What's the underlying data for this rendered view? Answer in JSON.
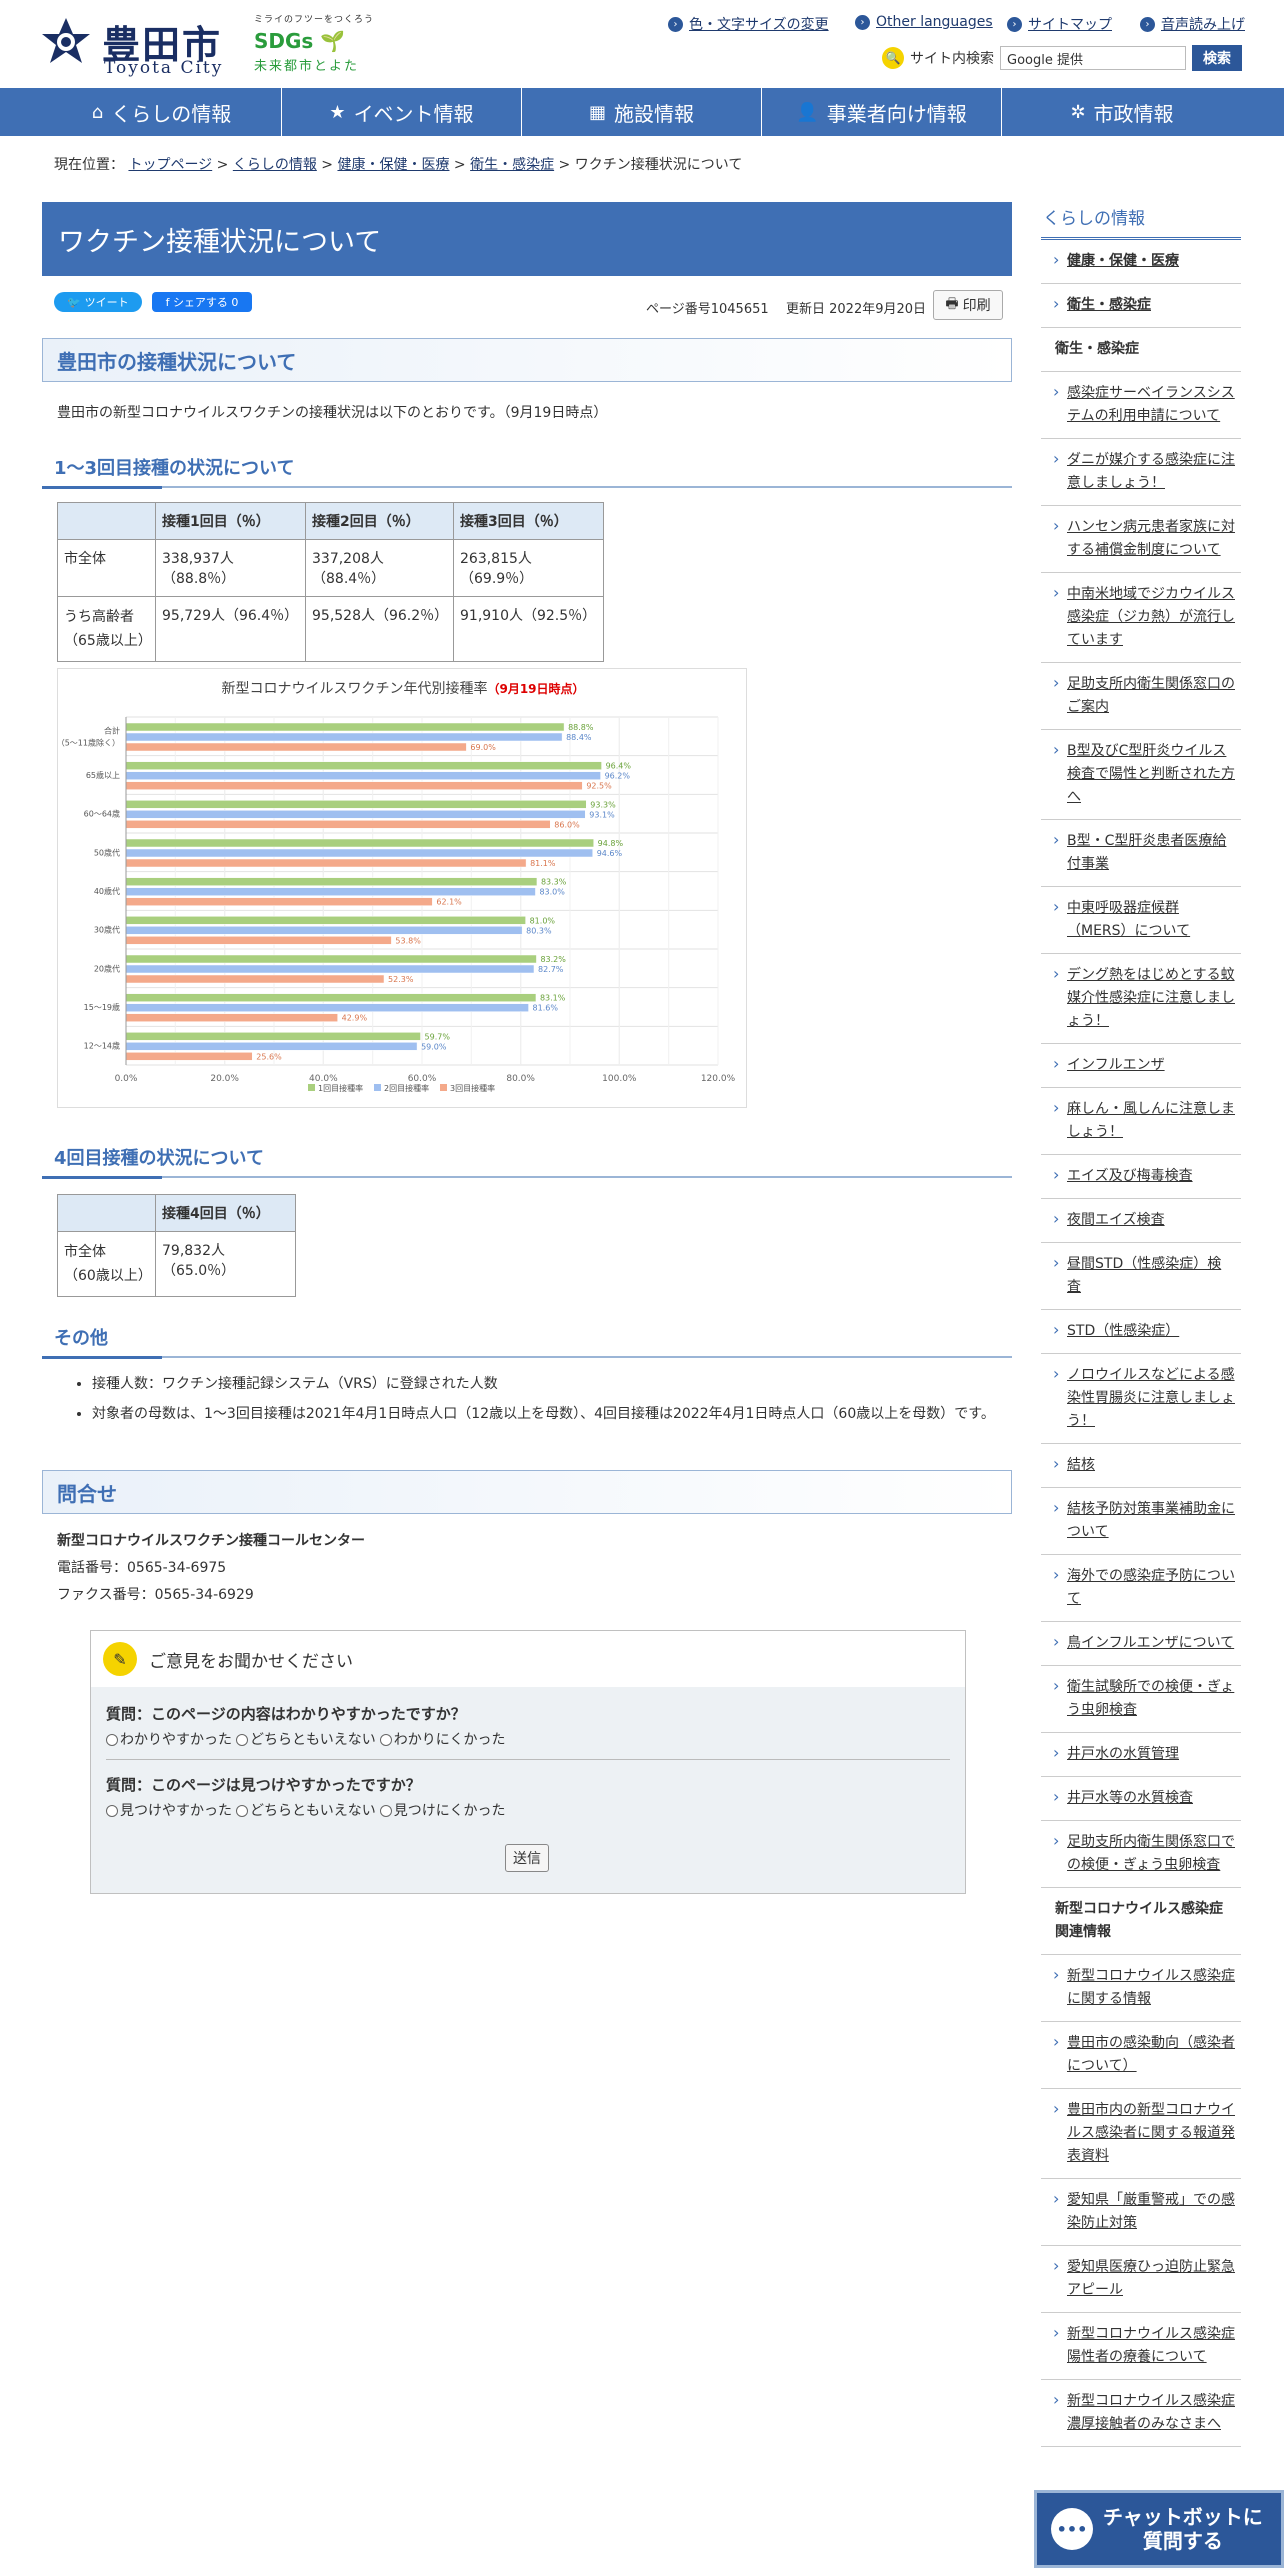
{
  "header": {
    "logo_jp": "豊田市",
    "logo_en": "Toyota City",
    "sdgs_tagline": "ミライのフツーをつくろう",
    "sdgs_mark": "SDGs",
    "sdgs_sub": "未来都市とよた",
    "util_links": [
      "色・文字サイズの変更",
      "Other languages",
      "サイトマップ",
      "音声読み上げ"
    ],
    "search_label": "サイト内検索",
    "search_placeholder": "Google 提供",
    "search_button": "検索"
  },
  "nav": {
    "items": [
      {
        "label": "くらしの情報",
        "icon": "home-icon"
      },
      {
        "label": "イベント情報",
        "icon": "star-icon"
      },
      {
        "label": "施設情報",
        "icon": "building-icon"
      },
      {
        "label": "事業者向け情報",
        "icon": "person-icon"
      },
      {
        "label": "市政情報",
        "icon": "gear-icon"
      }
    ]
  },
  "breadcrumb": {
    "prefix": "現在位置：",
    "links": [
      "トップページ",
      "くらしの情報",
      "健康・保健・医療",
      "衛生・感染症"
    ],
    "sep": " > ",
    "current": "ワクチン接種状況について"
  },
  "page": {
    "title": "ワクチン接種状況について",
    "tweet_label": "ツイート",
    "share_label": "シェアする 0",
    "page_number": "ページ番号1045651",
    "updated": "更新日 2022年9月20日",
    "print_label": "印刷",
    "h2_status": "豊田市の接種状況について",
    "intro": "豊田市の新型コロナウイルスワクチンの接種状況は以下のとおりです。（9月19日時点）",
    "h3_1to3": "1～3回目接種の状況について",
    "table1": {
      "headers": [
        "",
        "接種1回目（％）",
        "接種2回目（％）",
        "接種3回目（％）"
      ],
      "rows": [
        [
          "市全体",
          "338,937人（88.8％）",
          "337,208人（88.4％）",
          "263,815人（69.9％）"
        ],
        [
          "うち高齢者\n（65歳以上）",
          "95,729人（96.4％）",
          "95,528人（96.2％）",
          "91,910人（92.5％）"
        ]
      ]
    },
    "h3_4th": "4回目接種の状況について",
    "table2": {
      "headers": [
        "",
        "接種4回目（％）"
      ],
      "rows": [
        [
          "市全体\n（60歳以上）",
          "79,832人（65.0％）"
        ]
      ]
    },
    "h3_other": "その他",
    "bullets": [
      "接種人数：ワクチン接種記録システム（VRS）に登録された人数",
      "対象者の母数は、1～3回目接種は2021年4月1日時点人口（12歳以上を母数）、4回目接種は2022年4月1日時点人口（60歳以上を母数）です。"
    ],
    "h2_contact": "問合せ",
    "contact_name": "新型コロナウイルスワクチン接種コールセンター",
    "contact_tel": "電話番号：0565-34-6975",
    "contact_fax": "ファクス番号：0565-34-6929"
  },
  "survey": {
    "heading": "ご意見をお聞かせください",
    "q1": "質問：このページの内容はわかりやすかったですか？",
    "q1_options": [
      "わかりやすかった",
      "どちらともいえない",
      "わかりにくかった"
    ],
    "q2": "質問：このページは見つけやすかったですか？",
    "q2_options": [
      "見つけやすかった",
      "どちらともいえない",
      "見つけにくかった"
    ],
    "submit": "送信"
  },
  "chart_data": {
    "type": "bar",
    "title": "新型コロナウイルスワクチン年代別接種率",
    "title_note": "（9月19日時点）",
    "categories": [
      "合計\n（5～11歳除く）",
      "65歳以上",
      "60～64歳",
      "50歳代",
      "40歳代",
      "30歳代",
      "20歳代",
      "15～19歳",
      "12～14歳"
    ],
    "series": [
      {
        "name": "1回目接種率",
        "color": "#a9cf7e",
        "values": [
          88.8,
          96.4,
          93.3,
          94.8,
          83.3,
          81.0,
          83.2,
          83.1,
          59.7
        ]
      },
      {
        "name": "2回目接種率",
        "color": "#9fbff0",
        "values": [
          88.4,
          96.2,
          93.1,
          94.6,
          83.0,
          80.3,
          82.7,
          81.6,
          59.0
        ]
      },
      {
        "name": "3回目接種率",
        "color": "#f4a98a",
        "values": [
          69.0,
          92.5,
          86.0,
          81.1,
          62.1,
          53.8,
          52.3,
          42.9,
          25.6
        ]
      }
    ],
    "value_labels": [
      [
        "88.8%",
        "88.4%",
        "69.0%"
      ],
      [
        "96.4%",
        "96.2%",
        "92.5%"
      ],
      [
        "93.3%",
        "93.1%",
        "86.0%"
      ],
      [
        "94.8%",
        "94.6%",
        "81.1%"
      ],
      [
        "83.3%",
        "83.0%",
        "62.1%"
      ],
      [
        "81.0%",
        "80.3%",
        "53.8%"
      ],
      [
        "83.2%",
        "82.7%",
        "52.3%"
      ],
      [
        "83.1%",
        "81.6%",
        "42.9%"
      ],
      [
        "59.7%",
        "59.0%",
        "25.6%"
      ]
    ],
    "xticks": [
      "0.0%",
      "20.0%",
      "40.0%",
      "60.0%",
      "80.0%",
      "100.0%",
      "120.0%"
    ],
    "xlim": [
      0,
      120
    ],
    "grid": true,
    "legend": "bottom"
  },
  "sidebar": {
    "title": "くらしの情報",
    "top_links": [
      "健康・保健・医療",
      "衛生・感染症"
    ],
    "section1": "衛生・感染症",
    "links1": [
      "感染症サーベイランスシステムの利用申請について",
      "ダニが媒介する感染症に注意しましょう！",
      "ハンセン病元患者家族に対する補償金制度について",
      "中南米地域でジカウイルス感染症（ジカ熱）が流行しています",
      "足助支所内衛生関係窓口のご案内",
      "B型及びC型肝炎ウイルス検査で陽性と判断された方へ",
      "B型・C型肝炎患者医療給付事業",
      "中東呼吸器症候群（MERS）について",
      "デング熱をはじめとする蚊媒介性感染症に注意しましょう！",
      "インフルエンザ",
      "麻しん・風しんに注意しましょう！",
      "エイズ及び梅毒検査",
      "夜間エイズ検査",
      "昼間STD（性感染症）検査",
      "STD（性感染症）",
      "ノロウイルスなどによる感染性胃腸炎に注意しましょう！",
      "結核",
      "結核予防対策事業補助金について",
      "海外での感染症予防について",
      "鳥インフルエンザについて",
      "衛生試験所での検便・ぎょう虫卵検査",
      "井戸水の水質管理",
      "井戸水等の水質検査",
      "足助支所内衛生関係窓口での検便・ぎょう虫卵検査"
    ],
    "section2": "新型コロナウイルス感染症関連情報",
    "links2": [
      "新型コロナウイルス感染症に関する情報",
      "豊田市の感染動向（感染者について）",
      "豊田市内の新型コロナウイルス感染者に関する報道発表資料",
      "愛知県「厳重警戒」での感染防止対策",
      "愛知県医療ひっ迫防止緊急アピール",
      "新型コロナウイルス感染症陽性者の療養について",
      "新型コロナウイルス感染症濃厚接触者のみなさまへ"
    ]
  },
  "chatbot": {
    "line1": "チャットボットに",
    "line2": "質問する"
  }
}
